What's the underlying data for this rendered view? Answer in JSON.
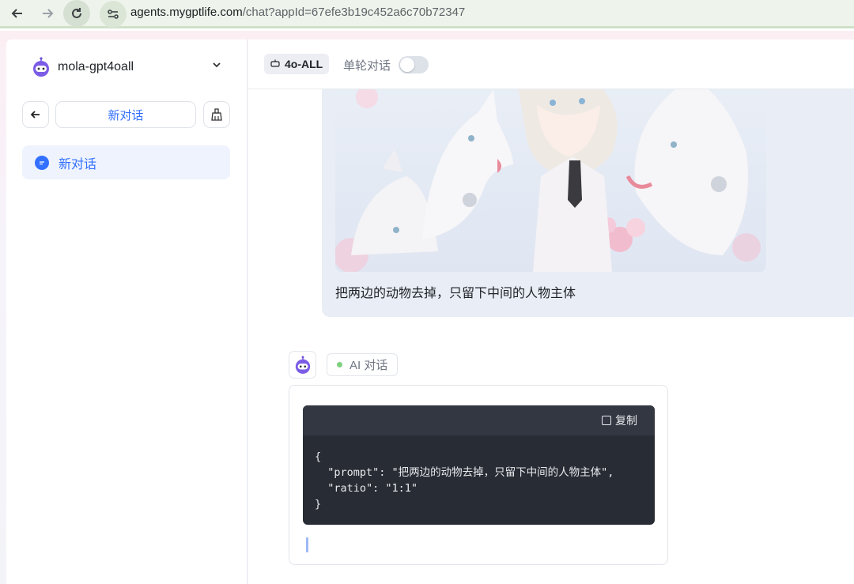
{
  "browser": {
    "url_host": "agents.mygptlife.com",
    "url_path": "/chat?appId=67efe3b19c452a6c70b72347"
  },
  "sidebar": {
    "app_name": "mola-gpt4oall",
    "new_chat_label": "新对话",
    "history": [
      {
        "label": "新对话",
        "active": true
      }
    ]
  },
  "header": {
    "model_label": "4o-ALL",
    "single_turn_label": "单轮对话",
    "single_turn_enabled": false
  },
  "chat": {
    "user_message": "把两边的动物去掉，只留下中间的人物主体",
    "ai_tag_label": "AI 对话",
    "copy_label": "复制",
    "code_lines": [
      "{",
      "  \"prompt\": \"把两边的动物去掉，只留下中间的人物主体\",",
      "  \"ratio\": \"1:1\"",
      "}"
    ]
  },
  "colors": {
    "accent": "#3370ff",
    "code_bg": "#282c34",
    "user_bubble": "#e9eef6",
    "status_dot": "#7fd17f"
  }
}
